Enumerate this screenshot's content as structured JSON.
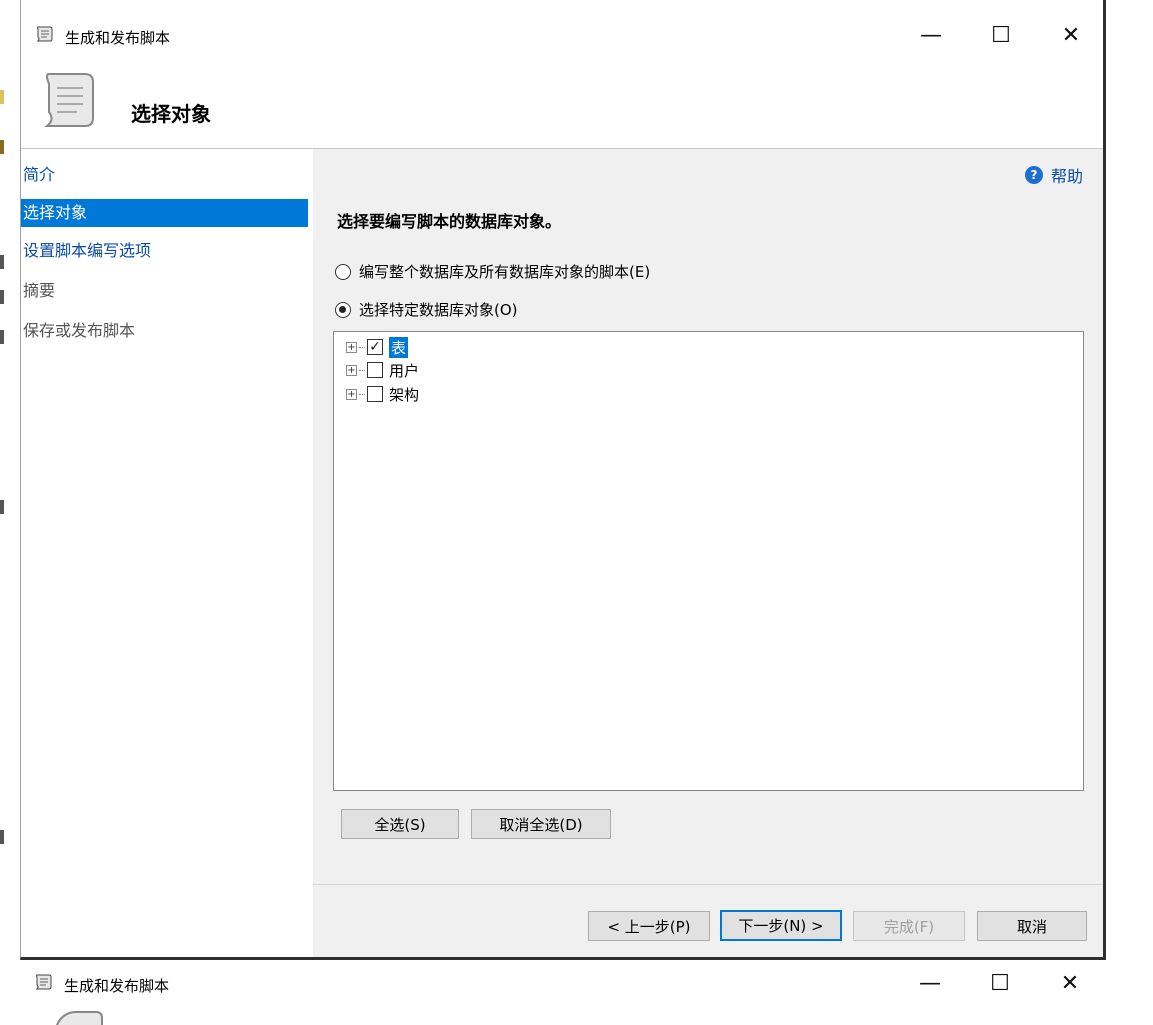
{
  "window": {
    "title": "生成和发布脚本",
    "header_title": "选择对象",
    "controls": {
      "minimize": "—",
      "maximize": "☐",
      "close": "✕"
    }
  },
  "sidebar": {
    "items": [
      {
        "label": "简介",
        "state": "link"
      },
      {
        "label": "选择对象",
        "state": "active"
      },
      {
        "label": "设置脚本编写选项",
        "state": "link"
      },
      {
        "label": "摘要",
        "state": "disabled"
      },
      {
        "label": "保存或发布脚本",
        "state": "disabled"
      }
    ]
  },
  "main": {
    "help_label": "帮助",
    "section_title": "选择要编写脚本的数据库对象。",
    "options": [
      {
        "label": "编写整个数据库及所有数据库对象的脚本(E)",
        "selected": false
      },
      {
        "label": "选择特定数据库对象(O)",
        "selected": true
      }
    ],
    "tree": [
      {
        "label": "表",
        "checked": true,
        "selected": true
      },
      {
        "label": "用户",
        "checked": false,
        "selected": false
      },
      {
        "label": "架构",
        "checked": false,
        "selected": false
      }
    ],
    "select_all": "全选(S)",
    "deselect_all": "取消全选(D)"
  },
  "footer": {
    "prev": "< 上一步(P)",
    "next": "下一步(N) >",
    "finish": "完成(F)",
    "cancel": "取消"
  },
  "colors": {
    "accent": "#0078d7",
    "link": "#0a4ca8",
    "panel": "#f0f0f0"
  }
}
